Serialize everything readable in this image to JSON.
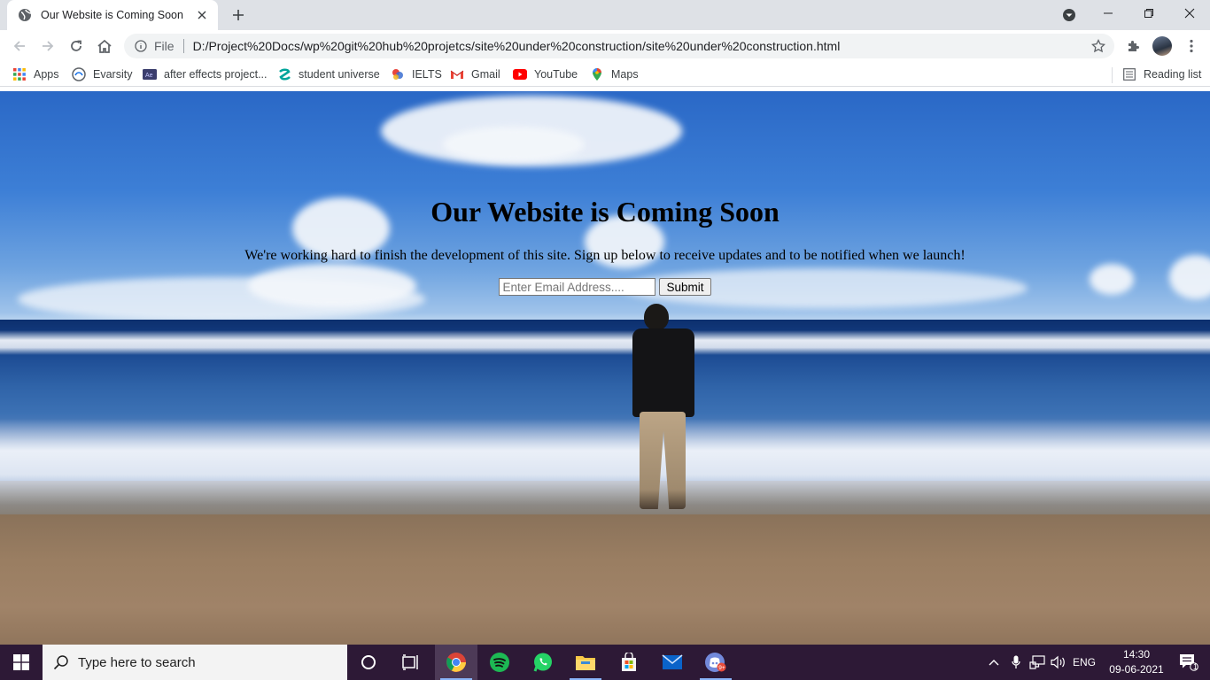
{
  "browser": {
    "tab": {
      "title": "Our Website is Coming Soon",
      "favicon": "globe-icon"
    },
    "address": {
      "scheme_label": "File",
      "url": "D:/Project%20Docs/wp%20git%20hub%20projetcs/site%20under%20construction/site%20under%20construction.html"
    },
    "bookmarks": [
      {
        "label": "Apps",
        "icon": "apps-grid-icon"
      },
      {
        "label": "Evarsity",
        "icon": "evarsity-icon"
      },
      {
        "label": "after effects project...",
        "icon": "after-effects-icon"
      },
      {
        "label": "student universe",
        "icon": "student-universe-icon"
      },
      {
        "label": "IELTS",
        "icon": "ielts-icon"
      },
      {
        "label": "Gmail",
        "icon": "gmail-icon"
      },
      {
        "label": "YouTube",
        "icon": "youtube-icon"
      },
      {
        "label": "Maps",
        "icon": "maps-icon"
      }
    ],
    "reading_list": "Reading list"
  },
  "page": {
    "heading": "Our Website is Coming Soon",
    "subtext": "We're working hard to finish the development of this site. Sign up below to receive updates and to be notified when we launch!",
    "email_placeholder": "Enter Email Address....",
    "submit_label": "Submit"
  },
  "taskbar": {
    "search_placeholder": "Type here to search",
    "language": "ENG",
    "time": "14:30",
    "date": "09-06-2021",
    "notification_count": "1",
    "apps": [
      "chrome-icon",
      "spotify-icon",
      "whatsapp-icon",
      "file-explorer-icon",
      "microsoft-store-icon",
      "mail-icon",
      "discord-icon"
    ]
  },
  "colors": {
    "tabbar_bg": "#dee1e6",
    "taskbar_bg": "#2d1936",
    "accent_blue": "#1a73e8"
  }
}
